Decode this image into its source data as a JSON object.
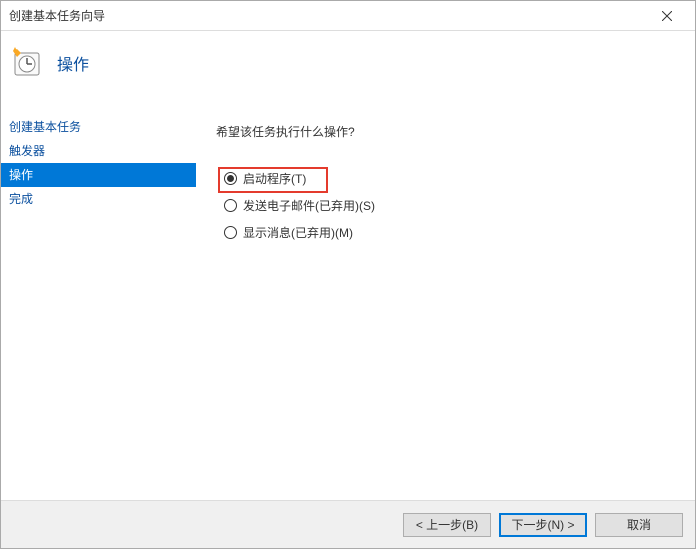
{
  "window": {
    "title": "创建基本任务向导"
  },
  "header": {
    "title": "操作"
  },
  "sidebar": {
    "items": [
      {
        "label": "创建基本任务",
        "active": false
      },
      {
        "label": "触发器",
        "active": false
      },
      {
        "label": "操作",
        "active": true
      },
      {
        "label": "完成",
        "active": false
      }
    ]
  },
  "content": {
    "question": "希望该任务执行什么操作?",
    "options": [
      {
        "label": "启动程序(T)",
        "checked": true,
        "highlight": true
      },
      {
        "label": "发送电子邮件(已弃用)(S)",
        "checked": false,
        "highlight": false
      },
      {
        "label": "显示消息(已弃用)(M)",
        "checked": false,
        "highlight": false
      }
    ]
  },
  "footer": {
    "back": "< 上一步(B)",
    "next": "下一步(N) >",
    "cancel": "取消"
  }
}
